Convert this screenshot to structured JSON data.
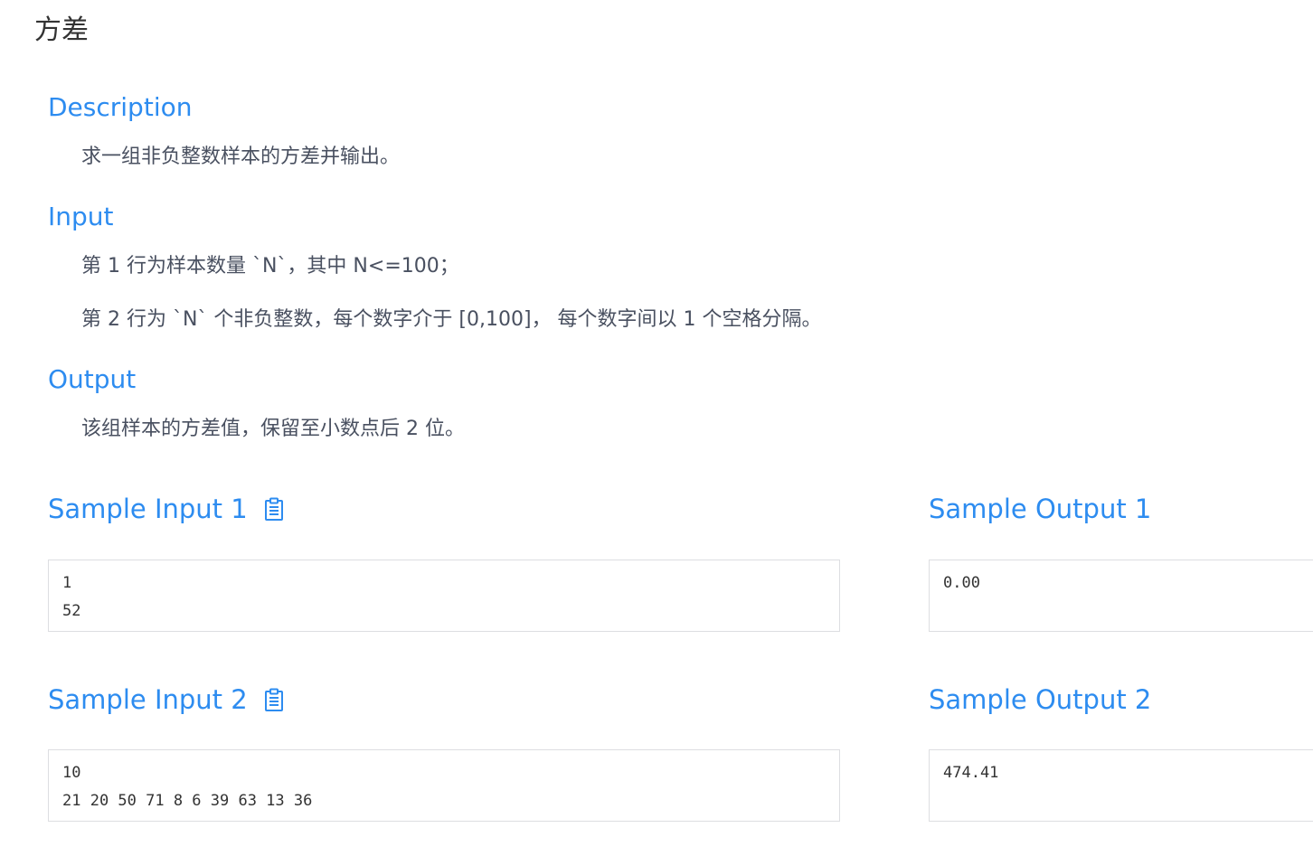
{
  "problem": {
    "title": "方差"
  },
  "description": {
    "heading": "Description",
    "text": "求一组非负整数样本的方差并输出。"
  },
  "input": {
    "heading": "Input",
    "lines": [
      "第 1 行为样本数量 `N`，其中 N<=100；",
      "第 2 行为 `N` 个非负整数，每个数字介于 [0,100]， 每个数字间以 1 个空格分隔。"
    ]
  },
  "output": {
    "heading": "Output",
    "text": "该组样本的方差值，保留至小数点后 2 位。"
  },
  "samples": [
    {
      "input_label": "Sample Input 1",
      "output_label": "Sample Output 1",
      "input_lines": [
        "1",
        "52"
      ],
      "output_lines": [
        "0.00"
      ]
    },
    {
      "input_label": "Sample Input 2",
      "output_label": "Sample Output 2",
      "input_lines": [
        "10",
        "21 20 50 71 8 6 39 63 13 36"
      ],
      "output_lines": [
        "474.41"
      ]
    }
  ],
  "colors": {
    "accent": "#2d8cf0",
    "text": "#495060",
    "border": "#dddee1"
  },
  "icons": {
    "copy": "clipboard-icon"
  }
}
